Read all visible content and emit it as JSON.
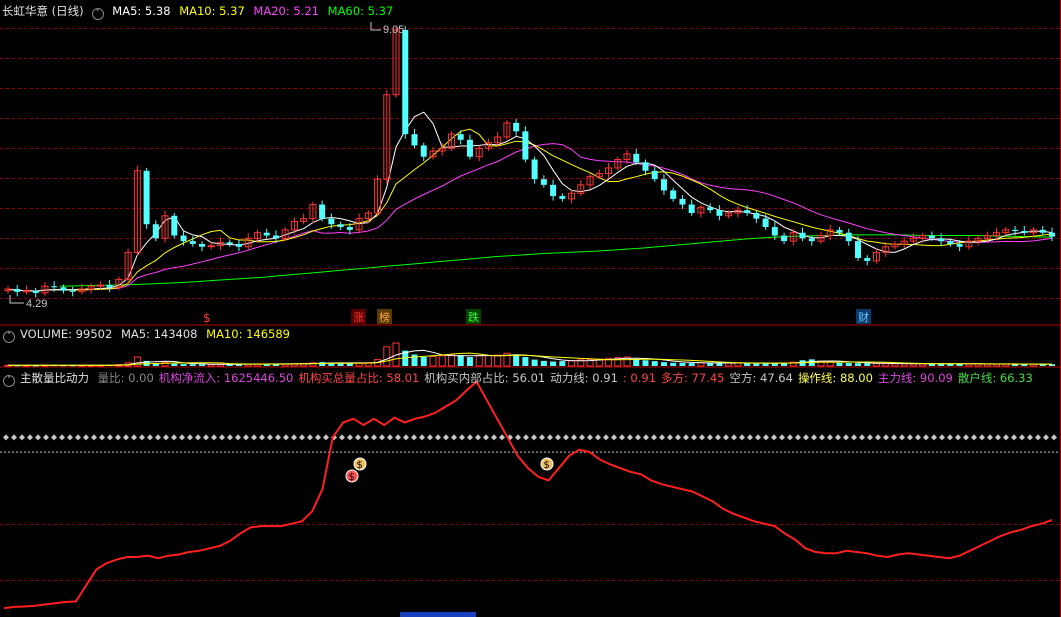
{
  "price_panel": {
    "title": "长虹华意 (日线)",
    "ma5": "MA5: 5.38",
    "ma10": "MA10: 5.37",
    "ma20": "MA20: 5.21",
    "ma60": "MA60: 5.37",
    "high_label": "9.05",
    "low_label": "4.29",
    "markers": [
      {
        "text": "$",
        "color": "#ff3333"
      },
      {
        "text": "涨",
        "color": "#ff3333",
        "bg": "#5a0000"
      },
      {
        "text": "榜",
        "color": "#ffaa44",
        "bg": "#5a3a00"
      },
      {
        "text": "跌",
        "color": "#33ff33",
        "bg": "#004400"
      },
      {
        "text": "财",
        "color": "#66ccff",
        "bg": "#0a3a6a"
      }
    ]
  },
  "volume_panel": {
    "label": "VOLUME: 99502",
    "ma5": "MA5: 143408",
    "ma10": "MA10: 146589"
  },
  "indicator_panel": {
    "name": "主散量比动力",
    "items": [
      {
        "text": "量比: 0.00",
        "color": "#888888"
      },
      {
        "text": "机构净流入: 1625446.50",
        "color": "#dd44dd"
      },
      {
        "text": "机构买总量占比: 58.01",
        "color": "#ff4444"
      },
      {
        "text": "机构买内部占比: 56.01",
        "color": "#c8c8c8"
      },
      {
        "text": "动力线: 0.91",
        "color": "#c8c8c8"
      },
      {
        "text": ": 0.91",
        "color": "#ff4444"
      },
      {
        "text": "多方: 77.45",
        "color": "#ff4444"
      },
      {
        "text": "空方: 47.64",
        "color": "#c8c8c8"
      },
      {
        "text": "操作线: 88.00",
        "color": "#ffff55"
      },
      {
        "text": "主力线: 90.09",
        "color": "#dd44dd"
      },
      {
        "text": "散户线: 66.33",
        "color": "#44dd44"
      }
    ]
  },
  "colors": {
    "up": "#ff3333",
    "down": "#54ffff",
    "ma5": "#ffffff",
    "ma10": "#ffff00",
    "ma20": "#ff40ff",
    "ma60": "#00ff00",
    "grid": "#8b0000",
    "power_line": "#ff2020"
  },
  "chart_data": {
    "type": "candlestick",
    "series": [
      {
        "close": [
          4.45,
          4.4,
          4.42,
          4.38,
          4.5,
          4.48,
          4.42,
          4.4,
          4.45,
          4.5,
          4.52,
          4.48,
          4.62,
          5.1,
          6.55,
          5.6,
          5.35,
          5.75,
          5.4,
          5.3,
          5.25,
          5.2,
          5.22,
          5.28,
          5.25,
          5.2,
          5.35,
          5.45,
          5.4,
          5.35,
          5.5,
          5.65,
          5.7,
          5.95,
          5.7,
          5.6,
          5.55,
          5.5,
          5.7,
          5.8,
          6.4,
          7.9,
          9.05,
          7.2,
          7.0,
          6.8,
          6.9,
          6.95,
          7.2,
          7.1,
          6.8,
          6.95,
          7.05,
          7.15,
          7.4,
          7.25,
          6.75,
          6.4,
          6.3,
          6.1,
          6.05,
          6.15,
          6.3,
          6.45,
          6.5,
          6.6,
          6.75,
          6.85,
          6.7,
          6.55,
          6.4,
          6.2,
          6.05,
          5.95,
          5.8,
          5.9,
          5.85,
          5.75,
          5.8,
          5.85,
          5.8,
          5.7,
          5.55,
          5.4,
          5.3,
          5.45,
          5.35,
          5.3,
          5.4,
          5.5,
          5.45,
          5.3,
          5.0,
          4.95,
          5.1,
          5.2,
          5.25,
          5.3,
          5.35,
          5.4,
          5.35,
          5.3,
          5.25,
          5.2,
          5.3,
          5.35,
          5.4,
          5.45,
          5.5,
          5.48,
          5.45,
          5.5,
          5.45,
          5.38
        ]
      }
    ],
    "ma60": [
      4.5,
      4.51,
      4.52,
      4.53,
      4.55,
      4.57,
      4.6,
      4.63,
      4.66,
      4.7,
      4.74,
      4.78,
      4.82,
      4.86,
      4.9,
      4.94,
      4.98,
      5.02,
      5.05,
      5.08,
      5.1,
      5.12,
      5.15,
      5.18,
      5.22,
      5.26,
      5.3,
      5.34,
      5.37,
      5.39,
      5.4,
      5.41,
      5.41,
      5.41,
      5.4,
      5.4,
      5.4,
      5.39,
      5.38,
      5.37
    ],
    "volume_values": [
      60,
      55,
      50,
      45,
      65,
      70,
      60,
      55,
      50,
      55,
      60,
      80,
      120,
      250,
      700,
      400,
      200,
      280,
      180,
      150,
      140,
      130,
      120,
      130,
      140,
      150,
      160,
      170,
      175,
      170,
      165,
      180,
      200,
      250,
      300,
      260,
      220,
      200,
      230,
      260,
      500,
      1500,
      1800,
      1200,
      900,
      700,
      750,
      800,
      900,
      850,
      700,
      800,
      820,
      850,
      1000,
      900,
      700,
      500,
      400,
      350,
      380,
      420,
      480,
      500,
      550,
      600,
      650,
      700,
      550,
      450,
      380,
      300,
      250,
      240,
      230,
      260,
      240,
      220,
      230,
      240,
      230,
      220,
      200,
      210,
      260,
      300,
      450,
      520,
      380,
      300,
      250,
      240,
      220,
      210,
      190,
      180,
      175,
      170,
      160,
      165,
      170,
      180,
      175,
      170,
      165,
      160,
      155,
      150,
      148,
      146,
      145,
      144,
      143,
      142
    ],
    "volume_ma5": 143408,
    "volume_ma10": 146589,
    "indicator": {
      "power_line": [
        1.5,
        2.5,
        2.8,
        3.5,
        4.5,
        5.5,
        6.5,
        7.0,
        20,
        33,
        38,
        41,
        43,
        43,
        44,
        42,
        44,
        45,
        47,
        48,
        50,
        52,
        56,
        62,
        67,
        68,
        68,
        68,
        70,
        72,
        80,
        98,
        140,
        152,
        155,
        150,
        155,
        150,
        156,
        152,
        155,
        157,
        160,
        165,
        170,
        178,
        185,
        170,
        155,
        140,
        125,
        115,
        108,
        105,
        115,
        125,
        130,
        128,
        122,
        118,
        115,
        112,
        110,
        105,
        102,
        100,
        98,
        96,
        92,
        88,
        82,
        78,
        75,
        72,
        70,
        68,
        62,
        57,
        50,
        47,
        46,
        46,
        48,
        47,
        46,
        44,
        43,
        45,
        46,
        45,
        44,
        43,
        42,
        44,
        48,
        52,
        56,
        60,
        63,
        65,
        68,
        70,
        73
      ],
      "operate_line": 88.0,
      "upper_dots": 100
    }
  }
}
